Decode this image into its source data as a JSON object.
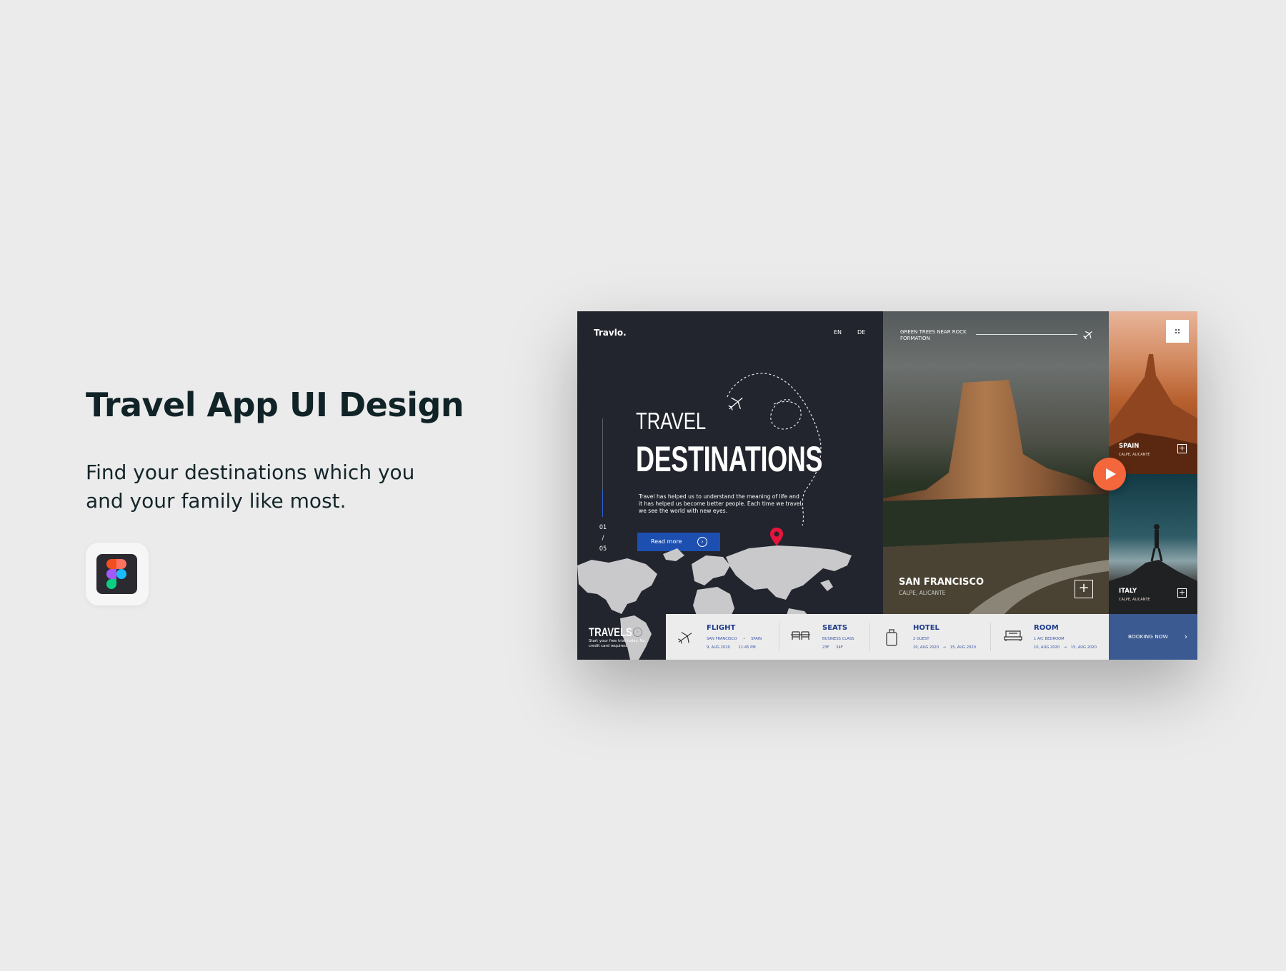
{
  "page": {
    "title": "Travel App UI Design",
    "subtitle": "Find your destinations which you and your family like most.",
    "tool_icon": "figma-logo-icon"
  },
  "app": {
    "brand": "Travlo.",
    "languages": [
      "EN",
      "DE"
    ],
    "counter": {
      "current": "01",
      "divider": "/",
      "total": "05"
    },
    "hero": {
      "line1": "TRAVEL",
      "line2": "DESTINATIONS",
      "description": "Travel has helped us to understand the meaning of life and it has helped us become better people. Each time we travel, we see the world with new eyes.",
      "button": "Read more"
    },
    "travels": {
      "title": "TRAVELS",
      "subtitle": "Start your free trial today. No credit card required."
    },
    "featured": {
      "caption": "GREEN TREES NEAR ROCK FORMATION",
      "title": "SAN FRANCISCO",
      "subtitle": "CALPE, ALICANTE"
    },
    "cards": [
      {
        "title": "SPAIN",
        "subtitle": "CALPE, ALICANTE"
      },
      {
        "title": "ITALY",
        "subtitle": "CALPE, ALICANTE"
      }
    ],
    "booking": {
      "flight": {
        "label": "FLIGHT",
        "from": "SAN FRANCISCO",
        "to": "SPAIN",
        "date": "9, AUG 2020",
        "time": "11:45 PM"
      },
      "seats": {
        "label": "SEATS",
        "class": "BUSINESS CLASS",
        "seat_a": "23F",
        "seat_b": "24F"
      },
      "hotel": {
        "label": "HOTEL",
        "guests": "2 GUEST",
        "from": "10, AUG 2020",
        "to": "15, AUG 2020"
      },
      "room": {
        "label": "ROOM",
        "type": "1 A/C BEDROOM",
        "from": "10, AUG 2020",
        "to": "15, AUG 2020"
      },
      "cta": "BOOKING NOW"
    }
  },
  "colors": {
    "background": "#ebebeb",
    "panel_dark": "#22252d",
    "accent_blue": "#1d4fb0",
    "play_orange": "#f4673d",
    "pin_red": "#e8143c",
    "booking_blue": "#3b5a91"
  }
}
